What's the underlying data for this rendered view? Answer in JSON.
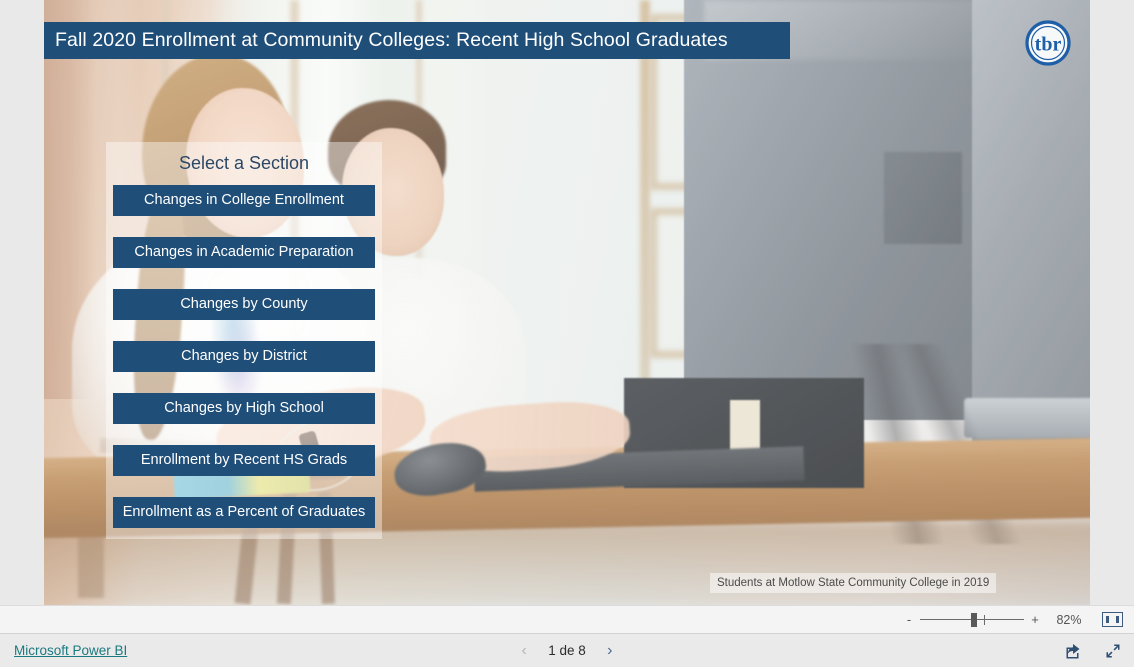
{
  "report": {
    "title": "Fall 2020 Enrollment at Community Colleges: Recent High School Graduates",
    "logo_text": "tbr",
    "photo_caption": "Students at Motlow State Community College in 2019",
    "accent_color": "#1f4e79",
    "panel_title": "Select a Section",
    "menu_items": [
      {
        "label": "Changes in College Enrollment"
      },
      {
        "label": "Changes in Academic Preparation"
      },
      {
        "label": "Changes by County"
      },
      {
        "label": "Changes by District"
      },
      {
        "label": "Changes by High School"
      },
      {
        "label": "Enrollment by Recent HS Grads"
      },
      {
        "label": "Enrollment as a Percent of Graduates"
      }
    ]
  },
  "zoom_bar": {
    "minus_label": "-",
    "plus_label": "+",
    "zoom_value": "82%",
    "fit_icon": "fit-to-page-icon"
  },
  "footer": {
    "brand_label": "Microsoft Power BI",
    "prev_icon": "chevron-left-icon",
    "next_icon": "chevron-right-icon",
    "page_label": "1 de 8",
    "share_icon": "share-icon",
    "fullscreen_icon": "fullscreen-icon"
  }
}
